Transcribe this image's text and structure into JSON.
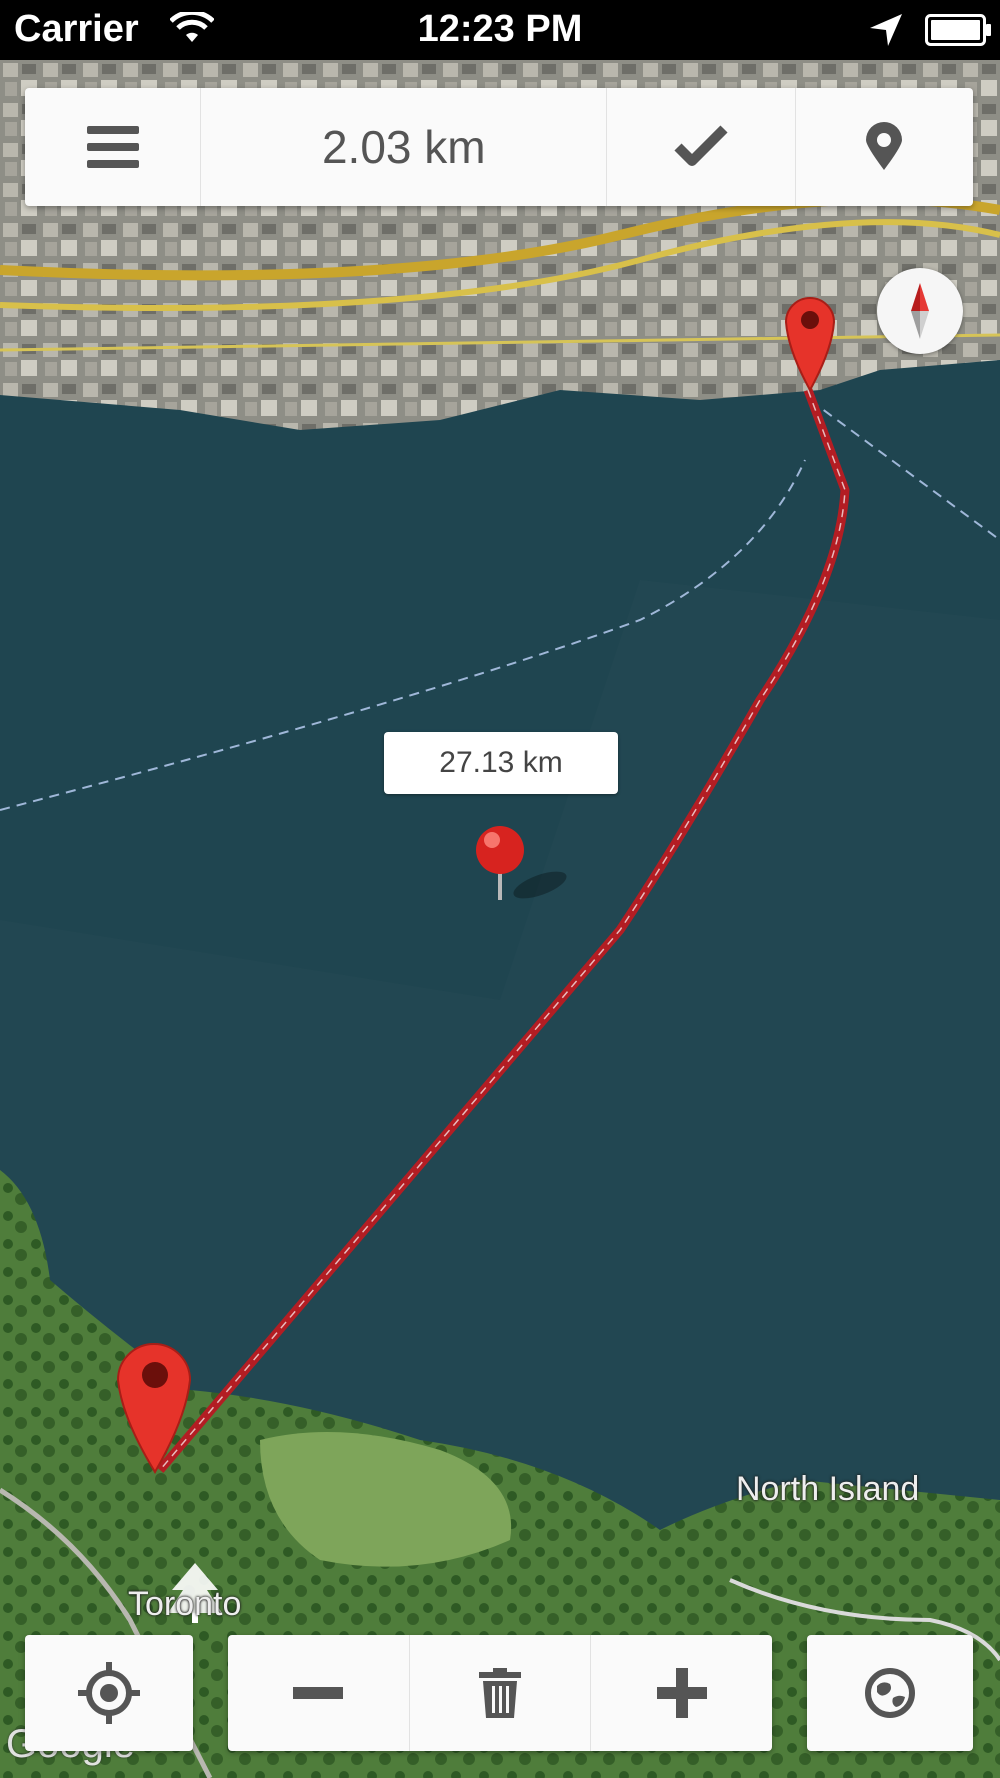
{
  "status_bar": {
    "carrier": "Carrier",
    "time": "12:23 PM"
  },
  "toolbar": {
    "distance": "2.03 km"
  },
  "map": {
    "measure_label": "27.13 km",
    "places": {
      "north_island": "North Island",
      "toronto": "Toronto"
    },
    "attribution": "Google"
  },
  "colors": {
    "route": "#b31d23",
    "pin": "#e6332a",
    "water": "#1f4550",
    "land": "#4d7a3a"
  },
  "icons": {
    "menu": "menu-icon",
    "confirm": "checkmark-icon",
    "pin": "map-pin-icon",
    "compass": "compass-icon",
    "locate": "locate-icon",
    "zoom_out": "minus-icon",
    "delete": "trash-icon",
    "zoom_in": "plus-icon",
    "map_type": "globe-icon"
  }
}
